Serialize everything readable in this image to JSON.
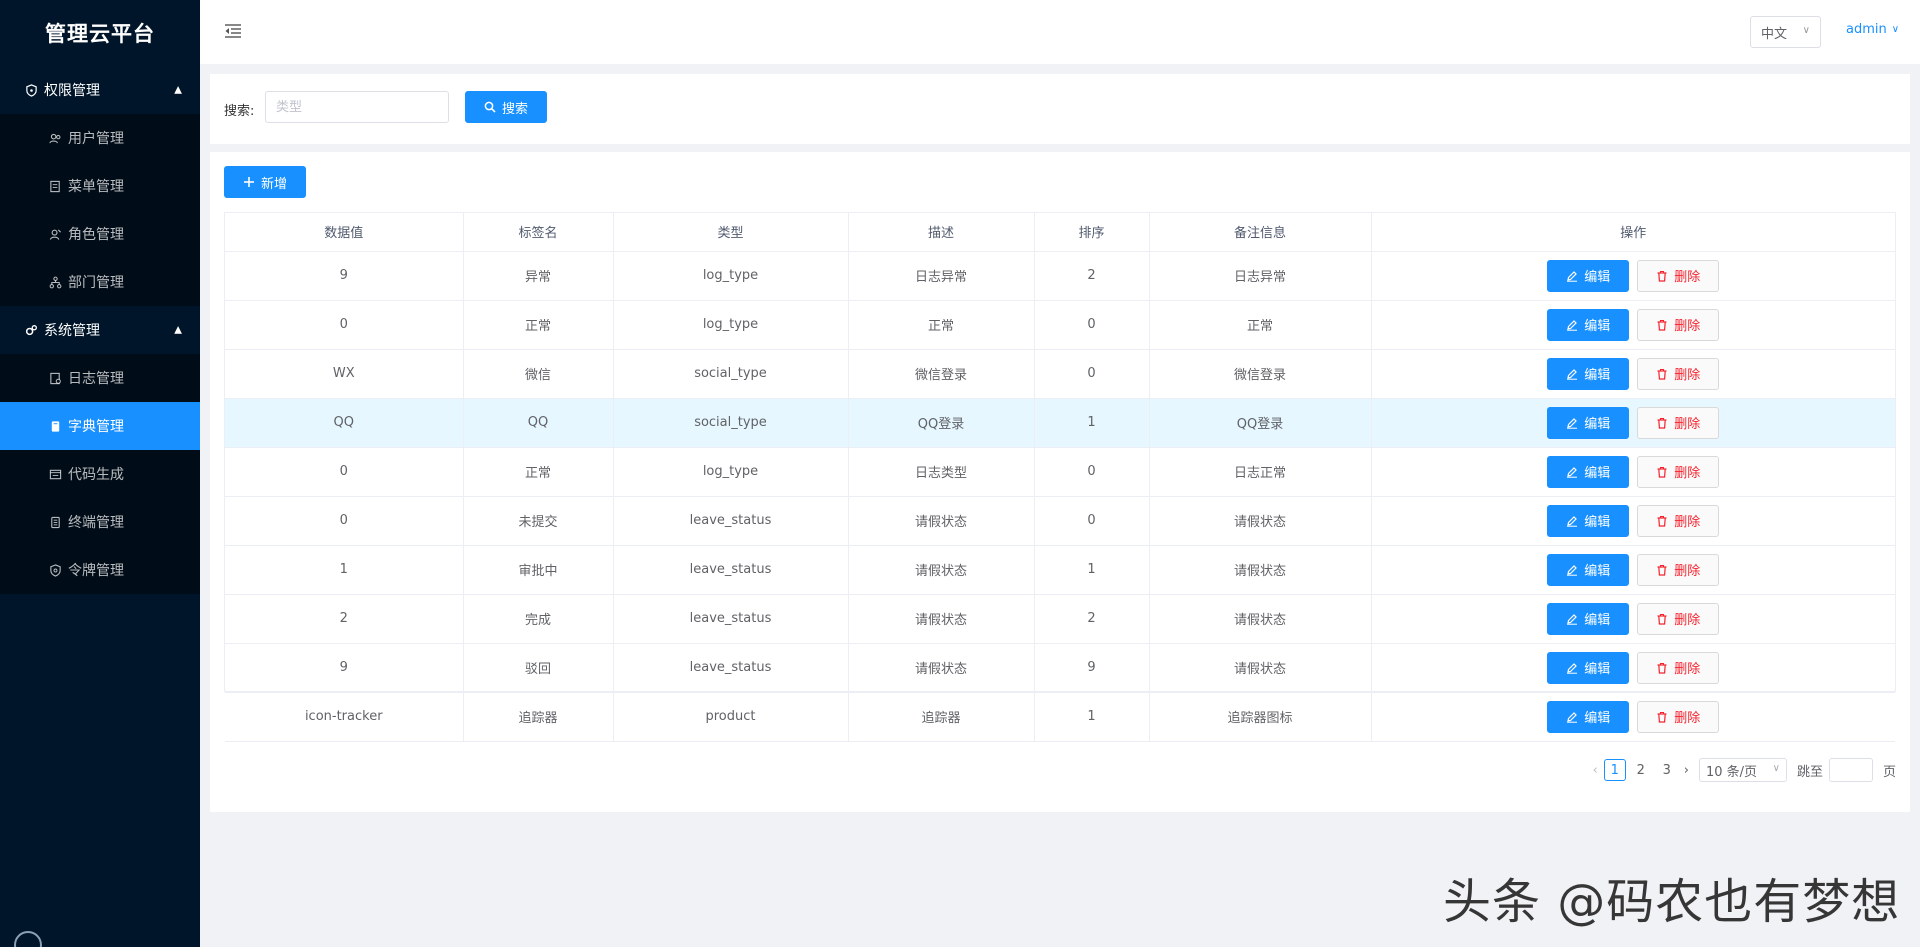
{
  "app": {
    "title": "管理云平台"
  },
  "sidebar": {
    "groups": [
      {
        "label": "权限管理",
        "items": [
          {
            "label": "用户管理",
            "icon": "users-icon"
          },
          {
            "label": "菜单管理",
            "icon": "menu-doc-icon"
          },
          {
            "label": "角色管理",
            "icon": "role-icon"
          },
          {
            "label": "部门管理",
            "icon": "org-icon"
          }
        ]
      },
      {
        "label": "系统管理",
        "items": [
          {
            "label": "日志管理",
            "icon": "log-icon"
          },
          {
            "label": "字典管理",
            "icon": "book-icon",
            "active": true
          },
          {
            "label": "代码生成",
            "icon": "code-icon"
          },
          {
            "label": "终端管理",
            "icon": "terminal-icon"
          },
          {
            "label": "令牌管理",
            "icon": "token-icon"
          }
        ]
      }
    ]
  },
  "header": {
    "language": "中文",
    "user": "admin"
  },
  "search": {
    "label": "搜索:",
    "placeholder": "类型",
    "button": "搜索"
  },
  "toolbar": {
    "add_label": "新增"
  },
  "table": {
    "columns": [
      "数据值",
      "标签名",
      "类型",
      "描述",
      "排序",
      "备注信息",
      "操作"
    ],
    "rows": [
      [
        "9",
        "异常",
        "log_type",
        "日志异常",
        "2",
        "日志异常"
      ],
      [
        "0",
        "正常",
        "log_type",
        "正常",
        "0",
        "正常"
      ],
      [
        "WX",
        "微信",
        "social_type",
        "微信登录",
        "0",
        "微信登录"
      ],
      [
        "QQ",
        "QQ",
        "social_type",
        "QQ登录",
        "1",
        "QQ登录"
      ],
      [
        "0",
        "正常",
        "log_type",
        "日志类型",
        "0",
        "日志正常"
      ],
      [
        "0",
        "未提交",
        "leave_status",
        "请假状态",
        "0",
        "请假状态"
      ],
      [
        "1",
        "审批中",
        "leave_status",
        "请假状态",
        "1",
        "请假状态"
      ],
      [
        "2",
        "完成",
        "leave_status",
        "请假状态",
        "2",
        "请假状态"
      ],
      [
        "9",
        "驳回",
        "leave_status",
        "请假状态",
        "9",
        "请假状态"
      ],
      [
        "icon-tracker",
        "追踪器",
        "product",
        "追踪器",
        "1",
        "追踪器图标"
      ]
    ],
    "edit_label": "编辑",
    "delete_label": "删除"
  },
  "pagination": {
    "pages": [
      "1",
      "2",
      "3"
    ],
    "current": "1",
    "page_size": "10 条/页",
    "jump_label": "跳至",
    "page_suffix": "页"
  },
  "watermark": "头条 @码农也有梦想",
  "colors": {
    "primary": "#1890ff",
    "sidebar_bg": "#001529",
    "danger": "#f5222d"
  }
}
